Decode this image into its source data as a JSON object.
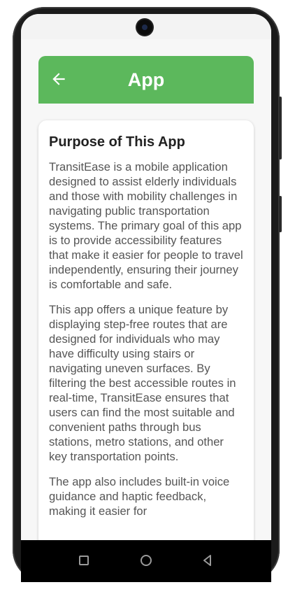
{
  "header": {
    "title": "App",
    "back_icon": "arrow-left-icon"
  },
  "card": {
    "title": "Purpose of This App",
    "paragraphs": [
      "TransitEase is a mobile application designed to assist elderly individuals and those with mobility challenges in navigating public transportation systems. The primary goal of this app is to provide accessibility features that make it easier for people to travel independently, ensuring their journey is comfortable and safe.",
      "This app offers a unique feature by displaying step-free routes that are designed for individuals who may have difficulty using stairs or navigating uneven surfaces. By filtering the best accessible routes in real-time, TransitEase ensures that users can find the most suitable and convenient paths through bus stations, metro stations, and other key transportation points.",
      "The app also includes built-in voice guidance and haptic feedback, making it easier for"
    ]
  },
  "navbar": {
    "icons": [
      "recents-square-icon",
      "home-circle-icon",
      "back-triangle-icon"
    ]
  },
  "colors": {
    "header_green": "#5cb85c",
    "screen_bg": "#f7f7f7",
    "text_gray": "#555555"
  }
}
